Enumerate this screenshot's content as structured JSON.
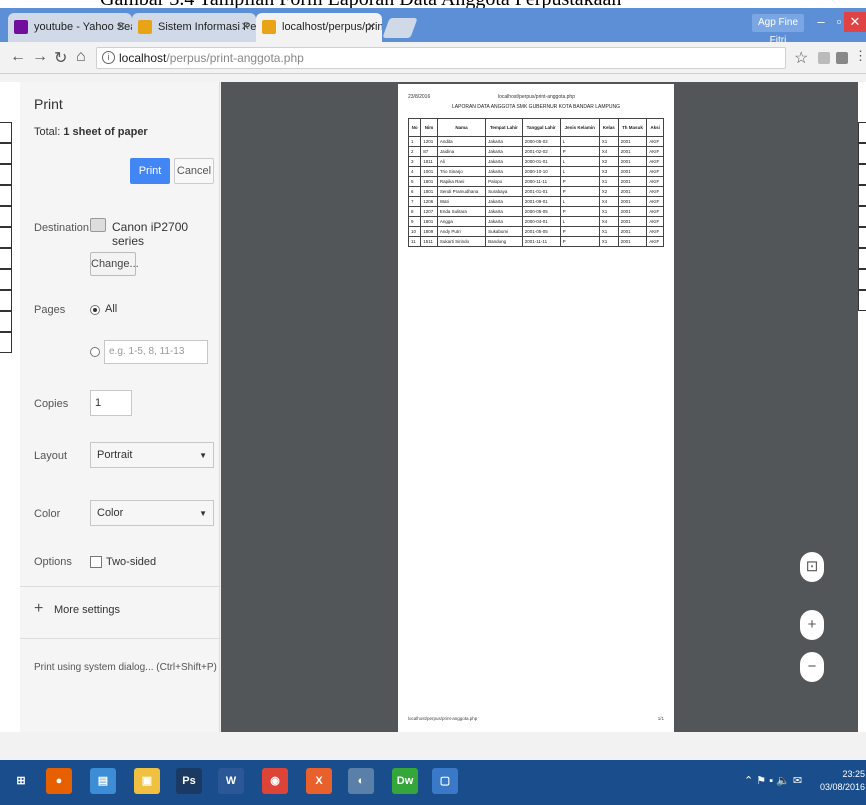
{
  "caption": "Gambar 3.4 Tampilan Form Laporan Data Anggota Perpustakaan",
  "browser": {
    "tabs": [
      {
        "label": "youtube - Yahoo Search",
        "color": "#720e9e"
      },
      {
        "label": "Sistem Informasi Perpus",
        "color": "#e8a317"
      },
      {
        "label": "localhost/perpus/print-a",
        "color": "#e8a317"
      }
    ],
    "user_button": "Agp Fine Fitri",
    "url_host": "localhost",
    "url_path": "/perpus/print-anggota.php"
  },
  "print_panel": {
    "title": "Print",
    "total_prefix": "Total: ",
    "total_value": "1 sheet of paper",
    "print_button": "Print",
    "cancel_button": "Cancel",
    "destination_label": "Destination",
    "destination_value": "Canon iP2700 series",
    "change_button": "Change...",
    "pages_label": "Pages",
    "pages_all": "All",
    "pages_placeholder": "e.g. 1-5, 8, 11-13",
    "copies_label": "Copies",
    "copies_value": "1",
    "layout_label": "Layout",
    "layout_value": "Portrait",
    "color_label": "Color",
    "color_value": "Color",
    "options_label": "Options",
    "two_sided": "Two-sided",
    "more_settings": "More settings",
    "system_dialog": "Print using system dialog... (Ctrl+Shift+P)"
  },
  "sheet": {
    "header_left": "23/8/2016",
    "header_mid": "localhost/perpus/print-anggota.php",
    "heading": "LAPORAN DATA ANGGOTA SMK GUBERNUR KOTA BANDAR LAMPUNG",
    "columns": [
      "No",
      "Nim",
      "Nama",
      "Tempat Lahir",
      "Tanggal Lahir",
      "Jenis Kelamin",
      "Kelas",
      "Th Masuk",
      "Aksi"
    ],
    "rows": [
      [
        "1",
        "1201",
        "Andita",
        "Jakarta",
        "2000-05-02",
        "L",
        "X1",
        "2001",
        "AKIF"
      ],
      [
        "2",
        "87",
        "Jaidina",
        "Jakarta",
        "2001-02-02",
        "P",
        "X4",
        "2001",
        "AKIF"
      ],
      [
        "3",
        "1811",
        "Ali",
        "Jakarta",
        "2000-01-01",
        "L",
        "X2",
        "2001",
        "AKIF"
      ],
      [
        "4",
        "1001",
        "Trio Sinarjo",
        "Jakarta",
        "2000-10-10",
        "L",
        "X3",
        "2001",
        "AKIF"
      ],
      [
        "5",
        "1801",
        "Rapika Rani",
        "Palopo",
        "2000-11-11",
        "P",
        "X1",
        "2001",
        "AKIF"
      ],
      [
        "6",
        "1801",
        "Sendi Pramudhana",
        "Surabaya",
        "2001-01-01",
        "P",
        "X2",
        "2001",
        "AKIF"
      ],
      [
        "7",
        "1206",
        "Wati",
        "Jakarta",
        "2001-09-01",
        "L",
        "X4",
        "2001",
        "AKIF"
      ],
      [
        "8",
        "1207",
        "Enda Sulitara",
        "Jakarta",
        "2000-05-05",
        "P",
        "X1",
        "2001",
        "AKIF"
      ],
      [
        "9",
        "1801",
        "Angga",
        "Jakarta",
        "2000-04-01",
        "L",
        "X4",
        "2001",
        "AKIF"
      ],
      [
        "10",
        "1809",
        "Andy Putri",
        "Sukabumi",
        "2001-05-05",
        "P",
        "X1",
        "2001",
        "AKIF"
      ],
      [
        "11",
        "1511",
        "Sukarti Sirindo",
        "Bandung",
        "2001-11-11",
        "P",
        "X1",
        "2001",
        "AKIF"
      ]
    ],
    "footer_left": "localhost/perpus/print-anggota.php",
    "footer_right": "1/1"
  },
  "zoom": {
    "fit": "⊡",
    "in": "+",
    "out": "−"
  },
  "taskbar": {
    "items": [
      {
        "name": "start-icon",
        "glyph": "⊞",
        "color": "#1a4d8c"
      },
      {
        "name": "firefox-icon",
        "glyph": "●",
        "color": "#e66000"
      },
      {
        "name": "files-icon",
        "glyph": "▤",
        "color": "#3c8dd6"
      },
      {
        "name": "explorer-icon",
        "glyph": "▣",
        "color": "#f0c040"
      },
      {
        "name": "photoshop-icon",
        "glyph": "Ps",
        "color": "#1b3a63"
      },
      {
        "name": "word-icon",
        "glyph": "W",
        "color": "#2b5797"
      },
      {
        "name": "chrome-icon",
        "glyph": "◉",
        "color": "#db4437"
      },
      {
        "name": "xampp-icon",
        "glyph": "X",
        "color": "#e8612c"
      },
      {
        "name": "app-icon",
        "glyph": "◐",
        "color": "#5a7fa8"
      },
      {
        "name": "dreamweaver-icon",
        "glyph": "Dw",
        "color": "#35a63a"
      },
      {
        "name": "window-icon",
        "glyph": "▢",
        "color": "#3a78c8"
      }
    ],
    "time": "23:25",
    "date": "03/08/2016"
  }
}
